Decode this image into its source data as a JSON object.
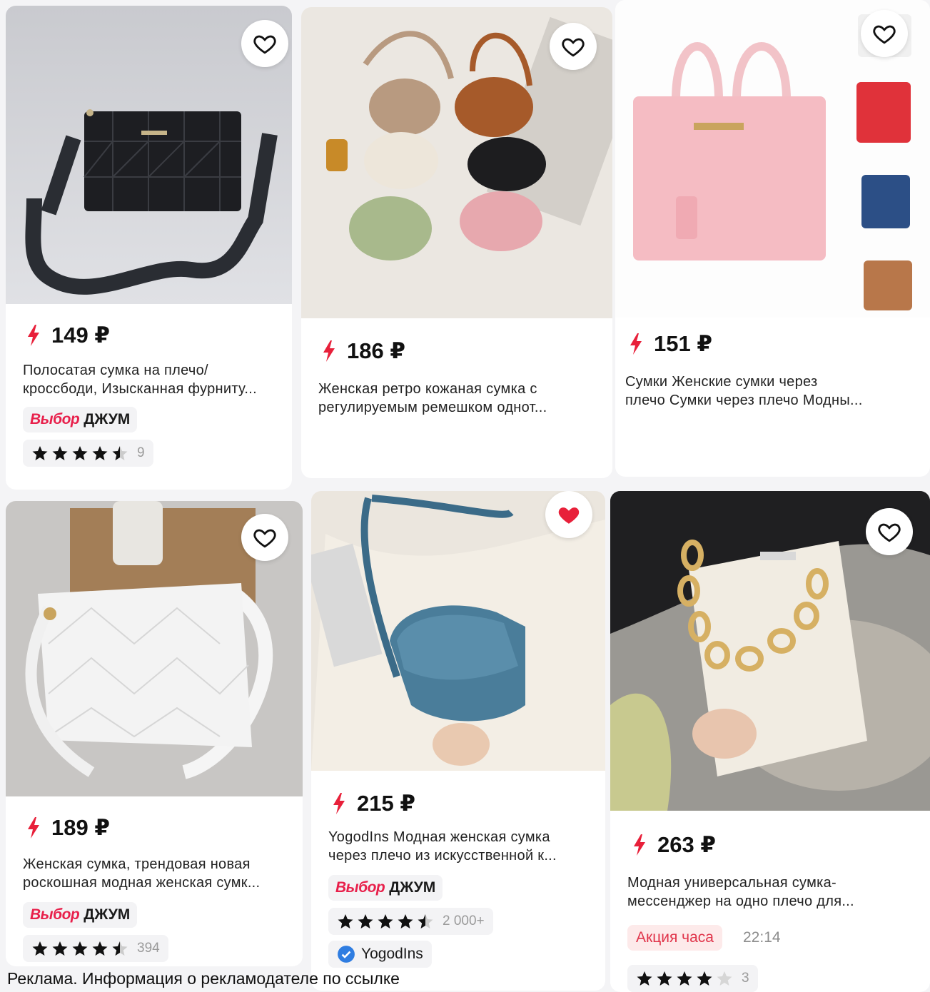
{
  "products": [
    {
      "price": "149 ₽",
      "title_line1": "Полосатая сумка на плечо/",
      "title_line2": "кроссбоди, Изысканная фурниту...",
      "choice_word": "Выбор",
      "choice_brand": "ДЖУМ",
      "rating_count": "9",
      "favorite": false
    },
    {
      "price": "186 ₽",
      "title_line1": "Женская ретро кожаная сумка с",
      "title_line2": "регулируемым ремешком однот...",
      "favorite": false
    },
    {
      "price": "151 ₽",
      "title_line1": "Сумки Женские сумки через",
      "title_line2": "плечо Сумки через плечо Модны...",
      "favorite": false
    },
    {
      "price": "189 ₽",
      "title_line1": "Женская сумка, трендовая новая",
      "title_line2": "роскошная модная женская сумк...",
      "choice_word": "Выбор",
      "choice_brand": "ДЖУМ",
      "rating_count": "394",
      "favorite": false
    },
    {
      "price": "215 ₽",
      "title_line1": "YogodIns Модная женская сумка",
      "title_line2": "через плечо из искусственной к...",
      "choice_word": "Выбор",
      "choice_brand": "ДЖУМ",
      "rating_count": "2 000+",
      "seller": "YogodIns",
      "favorite": true
    },
    {
      "price": "263 ₽",
      "title_line1": "Модная универсальная сумка-",
      "title_line2": "мессенджер на одно плечо для...",
      "promo": "Акция часа",
      "promo_time": "22:14",
      "rating_count": "3",
      "favorite": false
    }
  ],
  "ad_notice": "Реклама. Информация о рекламодателе по ссылке",
  "colors": {
    "accent": "#e8204b",
    "favorite_active": "#e8203a",
    "promo_bg": "#fdeaea"
  },
  "icons": [
    "heart-icon",
    "lightning-icon",
    "star-icon",
    "verified-icon"
  ]
}
